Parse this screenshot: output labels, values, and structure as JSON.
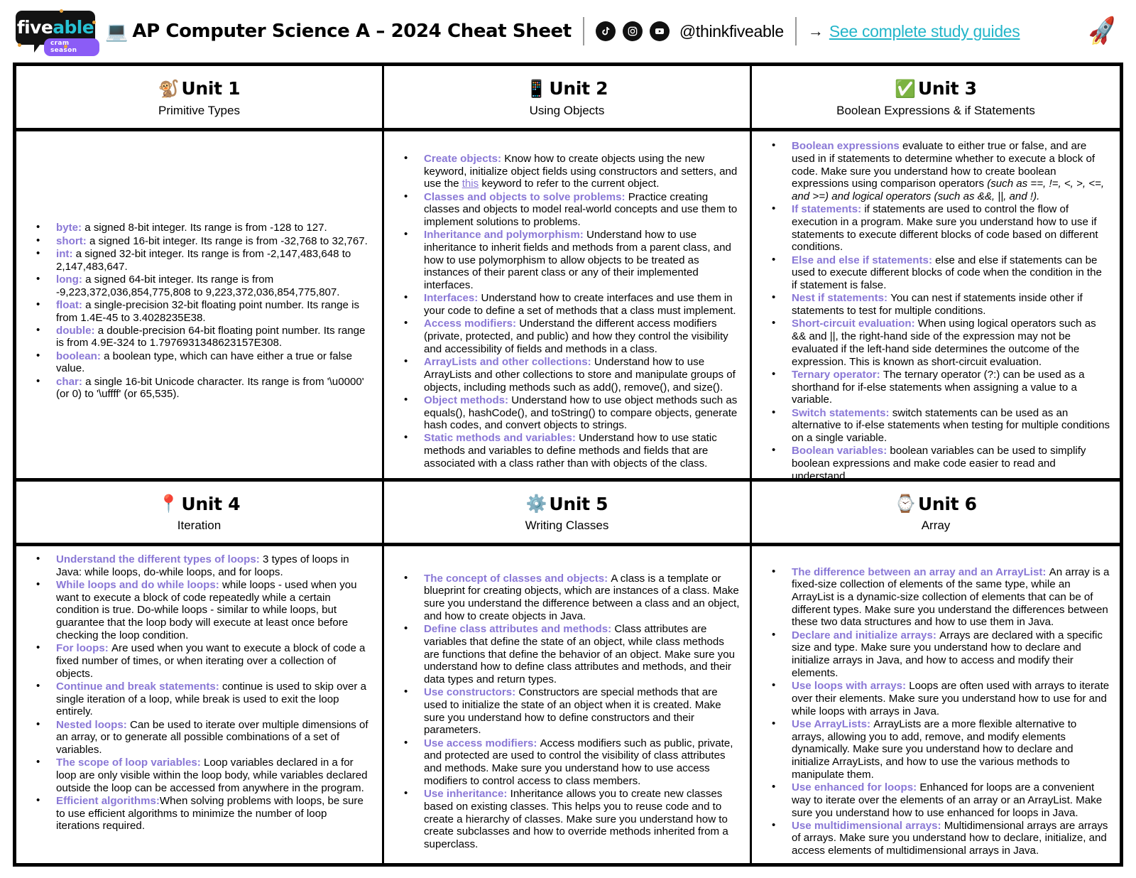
{
  "header": {
    "logo": {
      "word_part1": "five",
      "word_part2": "able",
      "badge": "cram season"
    },
    "laptop_icon": "💻",
    "title": "AP Computer Science A – 2024 Cheat Sheet",
    "socials": [
      "tiktok-icon",
      "instagram-icon",
      "youtube-icon"
    ],
    "handle": "@thinkfiveable",
    "arrow": "→",
    "guides_link": "See complete study guides",
    "rocket_icon": "🚀"
  },
  "units": [
    {
      "emoji": "🐒",
      "title": "Unit 1",
      "subtitle": "Primitive Types",
      "points": [
        {
          "term": "byte",
          "sep": ": ",
          "text": "a signed 8-bit integer. Its range is from -128 to 127."
        },
        {
          "term": "short",
          "sep": ": ",
          "text": "a signed 16-bit integer. Its range is from -32,768 to 32,767."
        },
        {
          "term": "int",
          "sep": ": ",
          "text": "a signed 32-bit integer. Its range is from -2,147,483,648 to 2,147,483,647."
        },
        {
          "term": "long",
          "sep": ": ",
          "text": "a signed 64-bit integer. Its range is from -9,223,372,036,854,775,808 to 9,223,372,036,854,775,807."
        },
        {
          "term": "float",
          "sep": ": ",
          "text": "a single-precision 32-bit floating point number. Its range is from 1.4E-45 to 3.4028235E38."
        },
        {
          "term": "double",
          "sep": ": ",
          "text": "a double-precision 64-bit floating point number. Its range is from 4.9E-324 to 1.7976931348623157E308."
        },
        {
          "term": "boolean",
          "sep": ": ",
          "text": "a boolean type, which can have either a true or false value."
        },
        {
          "term": "char",
          "sep": ": ",
          "text": "a single 16-bit Unicode character. Its range is from '\\u0000' (or 0) to '\\uffff' (or 65,535)."
        }
      ]
    },
    {
      "emoji": "📱",
      "title": "Unit 2",
      "subtitle": "Using Objects",
      "points": [
        {
          "term": "Create objects:",
          "sep": " ",
          "text": "Know how to create objects using the new keyword, initialize object fields using constructors and setters, and use the this keyword to refer to the current object."
        },
        {
          "term": "Classes and objects to solve problems",
          "sep": ": ",
          "text": "Practice creating classes and objects to model real-world concepts and use them to implement solutions to problems."
        },
        {
          "term": "Inheritance and polymorphism:",
          "sep": " ",
          "text": "Understand how to use inheritance to inherit fields and methods from a parent class, and how to use polymorphism to allow objects to be treated as instances of their parent class or any of their implemented interfaces."
        },
        {
          "term": "Interfaces",
          "sep": ": ",
          "text": "Understand how to create interfaces and use them in your code to define a set of methods that a class must implement."
        },
        {
          "term": "Access modifiers",
          "sep": ": ",
          "text": "Understand the different access modifiers (private, protected, and public) and how they control the visibility and accessibility of fields and methods in a class."
        },
        {
          "term": "ArrayLists and other collections",
          "sep": ": ",
          "text": "Understand how to use ArrayLists and other collections to store and manipulate groups of objects, including methods such as add(), remove(), and size()."
        },
        {
          "term": "Object methods",
          "sep": ": ",
          "text": "Understand how to use object methods such as equals(), hashCode(), and toString() to compare objects, generate hash codes, and convert objects to strings."
        },
        {
          "term": "Static methods and variables",
          "sep": ": ",
          "text": "Understand how to use static methods and variables to define methods and fields that are associated with a class rather than with objects of the class."
        }
      ]
    },
    {
      "emoji": "✅",
      "title": "Unit 3",
      "subtitle": "Boolean Expressions & if Statements",
      "points": [
        {
          "term": "Boolean expressions",
          "sep": " ",
          "text": "evaluate to either true or false, and are used in if statements to determine whether to execute a block of code. Make sure you understand how to create boolean expressions using comparison operators ",
          "italic": "(such as ==, !=, <, >, <=, and >=) and logical operators (such as &&, ||, and !)."
        },
        {
          "term": "If statements",
          "sep": ": ",
          "text": "if statements are used to control the flow of execution in a program. Make sure you understand how to use if statements to execute different blocks of code based on different conditions."
        },
        {
          "term": "Else and else if statements",
          "sep": ": ",
          "text": "else and else if statements can be used to execute different blocks of code when the condition in the if statement is false."
        },
        {
          "term": "Nest if statements:",
          "sep": " ",
          "text": "You can nest if statements inside other if statements to test for multiple conditions."
        },
        {
          "term": "Short-circuit evaluation",
          "sep": ": ",
          "text": "When using logical operators such as && and ||, the right-hand side of the expression may not be evaluated if the left-hand side determines the outcome of the expression. This is known as short-circuit evaluation."
        },
        {
          "term": "Ternary operator:",
          "sep": " ",
          "text": "The ternary operator (?:) can be used as a shorthand for if-else statements when assigning a value to a variable."
        },
        {
          "term": "Switch statements:",
          "sep": " ",
          "text": "switch statements can be used as an alternative to if-else statements when testing for multiple conditions on a single variable."
        },
        {
          "term": "Boolean variables:",
          "sep": " ",
          "text": "boolean variables can be used to simplify boolean expressions and make code easier to read and understand."
        }
      ]
    },
    {
      "emoji": "📍",
      "title": "Unit 4",
      "subtitle": "Iteration",
      "points": [
        {
          "term": "Understand the different types of loops:",
          "sep": " ",
          "text": "3 types of loops in Java: while loops, do-while loops, and for loops."
        },
        {
          "term": "While loops and do while loops:",
          "sep": " ",
          "text": "while loops - used when you want to execute a block of code repeatedly while a certain condition is true. Do-while loops - similar to while loops, but guarantee that the loop body will execute at least once before checking the loop condition."
        },
        {
          "term": "For loops:",
          "sep": " ",
          "text": "Are used when you want to execute a block of code a fixed number of times, or when iterating over a collection of objects."
        },
        {
          "term": "Continue and break statements:",
          "sep": " ",
          "text": "continue is used to skip over a single iteration of a loop, while break is used to exit the loop entirely."
        },
        {
          "term": "Nested loops",
          "sep": ": ",
          "text": "Can be used to iterate over multiple dimensions of an array, or to generate all possible combinations of a set of variables."
        },
        {
          "term": "The scope of loop variables",
          "sep": ": ",
          "text": "Loop variables declared in a for loop are only visible within the loop body, while variables declared outside the loop can be accessed from anywhere in the program."
        },
        {
          "term": "Efficient algorithms:",
          "sep": "",
          "text": "When solving problems with loops, be sure to use efficient algorithms to minimize the number of loop iterations required."
        }
      ]
    },
    {
      "emoji": "⚙️",
      "title": "Unit 5",
      "subtitle": "Writing Classes",
      "points": [
        {
          "term": "The concept of classes and objects:",
          "sep": " ",
          "text": "A class is a template or blueprint for creating objects, which are instances of a class. Make sure you understand the difference between a class and an object, and how to create objects in Java."
        },
        {
          "term": "Define class attributes and methods:",
          "sep": " ",
          "text": "Class attributes are variables that define the state of an object, while class methods are functions that define the behavior of an object. Make sure you understand how to define class attributes and methods, and their data types and return types."
        },
        {
          "term": "Use constructors:",
          "sep": " ",
          "text": "Constructors are special methods that are used to initialize the state of an object when it is created. Make sure you understand how to define constructors and their parameters."
        },
        {
          "term": "Use access modifiers:",
          "sep": " ",
          "text": "Access modifiers such as public, private, and protected are used to control the visibility of class attributes and methods. Make sure you understand how to use access modifiers to control access to class members."
        },
        {
          "term": "Use inheritance:",
          "sep": " ",
          "text": "Inheritance allows you to create new classes based on existing classes. This helps you to reuse code and to create a hierarchy of classes. Make sure you understand how to create subclasses and how to override methods inherited from a superclass."
        }
      ]
    },
    {
      "emoji": "⌚",
      "title": "Unit 6",
      "subtitle": "Array",
      "points": [
        {
          "term": "The difference between an array and an ArrayList",
          "sep": ": ",
          "text": "An array is a fixed-size collection of elements of the same type, while an ArrayList is a dynamic-size collection of elements that can be of different types. Make sure you understand the differences between these two data structures and how to use them in Java."
        },
        {
          "term": "Declare and initialize arrays:",
          "sep": " ",
          "text": "Arrays are declared with a specific size and type. Make sure you understand how to declare and initialize arrays in Java, and how to access and modify their elements."
        },
        {
          "term": "Use loops with arrays:",
          "sep": " ",
          "text": "Loops are often used with arrays to iterate over their elements. Make sure you understand how to use for and while loops with arrays in Java."
        },
        {
          "term": "Use ArrayLists:",
          "sep": " ",
          "text": "ArrayLists are a more flexible alternative to arrays, allowing you to add, remove, and modify elements dynamically. Make sure you understand how to declare and initialize ArrayLists, and how to use the various methods to manipulate them."
        },
        {
          "term": "Use enhanced for loops",
          "sep": ": ",
          "text": "Enhanced for loops are a convenient way to iterate over the elements of an array or an ArrayList. Make sure you understand how to use enhanced for loops in Java."
        },
        {
          "term": "Use multidimensional arrays",
          "sep": ": ",
          "text": "Multidimensional arrays are arrays of arrays. Make sure you understand how to declare, initialize, and access elements of multidimensional arrays in Java."
        }
      ]
    }
  ],
  "colors": {
    "accent_purple": "#8a78d6",
    "link_cyan": "#23b5c9",
    "logo_teal": "#27c2d4",
    "badge_purple": "#8b5cf6"
  }
}
